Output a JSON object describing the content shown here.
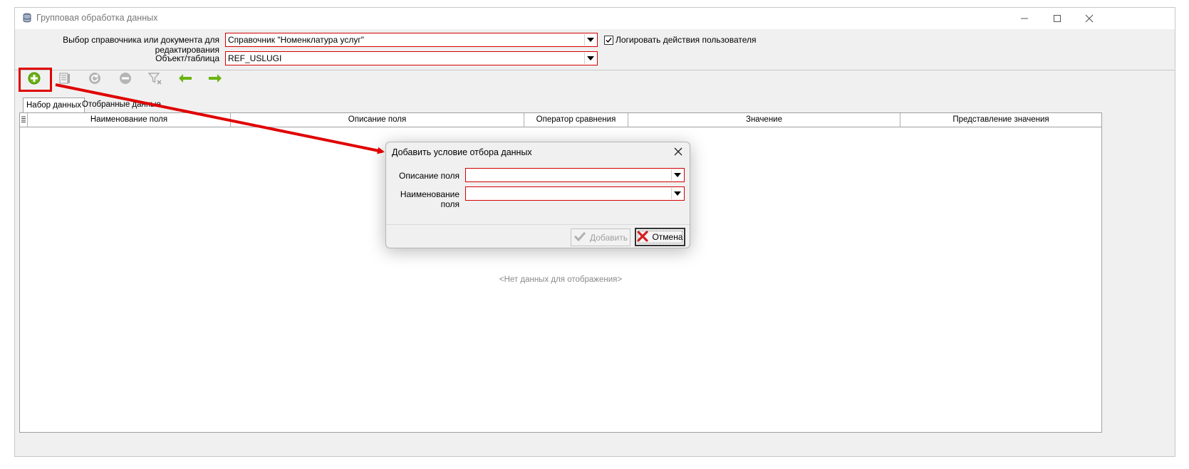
{
  "window": {
    "title": "Групповая обработка данных",
    "icon": "database-icon"
  },
  "form": {
    "source_label": "Выбор справочника или документа для редактирования",
    "source_value": "Справочник \"Номенклатура услуг\"",
    "log_label": "Логировать действия пользователя",
    "log_checked": true,
    "object_label": "Объект/таблица",
    "object_value": "REF_USLUGI"
  },
  "toolbar": {
    "buttons": [
      "add-icon",
      "edit-icon",
      "refresh-icon",
      "remove-icon",
      "clear-filter-icon",
      "arrow-left-icon",
      "arrow-right-icon"
    ]
  },
  "tabs": [
    {
      "label": "Набор данных",
      "active": true
    },
    {
      "label": "Отобранные данные",
      "active": false
    }
  ],
  "grid": {
    "columns": [
      "Наименование поля",
      "Описание поля",
      "Оператор сравнения",
      "Значение",
      "Представление значения"
    ],
    "empty_text": "<Нет данных для отображения>"
  },
  "dialog": {
    "title": "Добавить условие отбора данных",
    "field_desc_label": "Описание поля",
    "field_desc_value": "",
    "field_name_label": "Наименование поля",
    "field_name_value": "",
    "add_label": "Добавить",
    "cancel_label": "Отмена"
  },
  "colors": {
    "annotation": "#e00000",
    "required_border": "#d40000",
    "accent_green": "#6ab30f"
  }
}
